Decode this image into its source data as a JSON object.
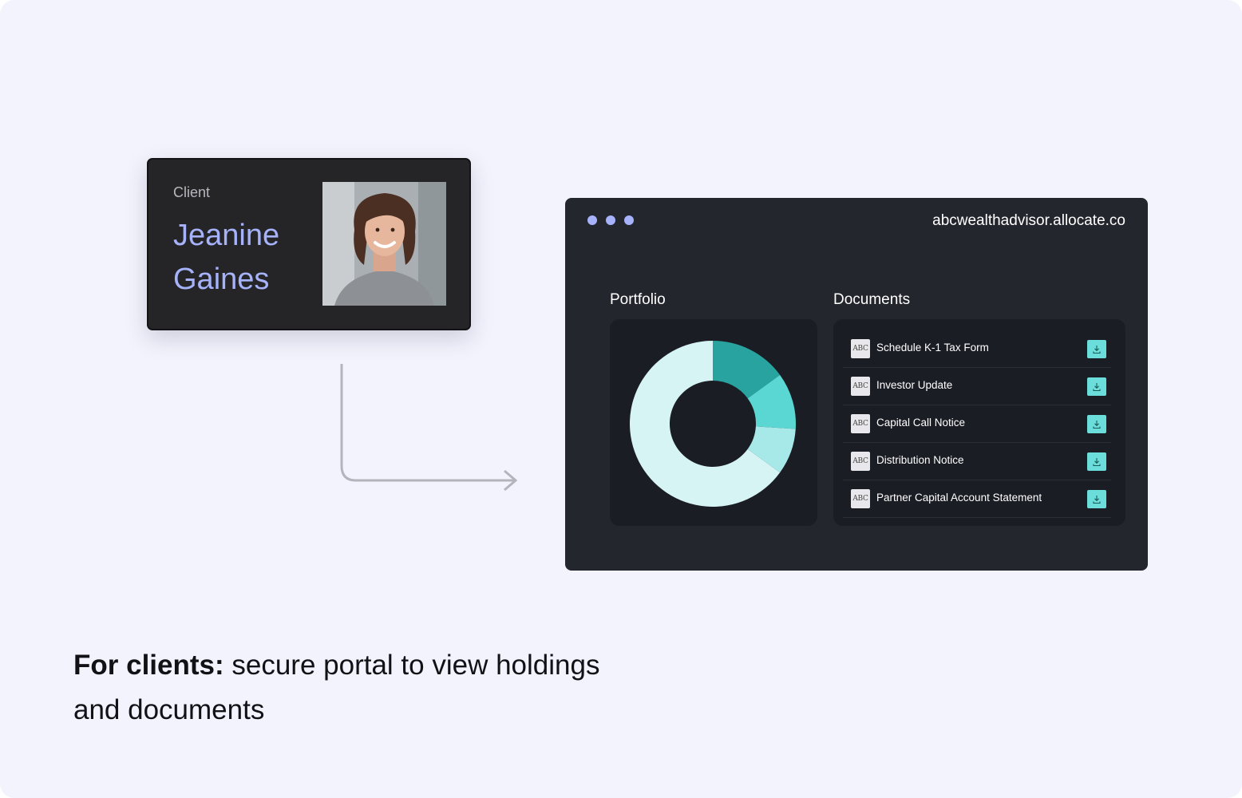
{
  "client_card": {
    "label": "Client",
    "first_name": "Jeanine",
    "last_name": "Gaines",
    "avatar_icon": "client-avatar-photo"
  },
  "window": {
    "url": "abcwealthadvisor.allocate.co",
    "portfolio": {
      "title": "Portfolio",
      "chart_data": {
        "type": "pie",
        "donut": true,
        "title": "",
        "slices": [
          {
            "value": 15,
            "color": "#28a3a0"
          },
          {
            "value": 11,
            "color": "#5ad6d3"
          },
          {
            "value": 9,
            "color": "#a6e9e8"
          },
          {
            "value": 65,
            "color": "#d7f4f4"
          }
        ]
      }
    },
    "documents": {
      "title": "Documents",
      "file_icon_text": "ABC",
      "items": [
        {
          "name": "Schedule K-1 Tax Form"
        },
        {
          "name": "Investor Update"
        },
        {
          "name": "Capital Call Notice"
        },
        {
          "name": "Distribution Notice"
        },
        {
          "name": "Partner Capital Account Statement"
        }
      ],
      "download_icon": "download-icon"
    },
    "dot_color": "#a6b3fb"
  },
  "caption": {
    "bold": "For clients:",
    "text": " secure portal to view holdings and documents"
  },
  "colors": {
    "background": "#f3f3fd",
    "accent": "#a6b3fb",
    "teal": "#6bdedb"
  }
}
